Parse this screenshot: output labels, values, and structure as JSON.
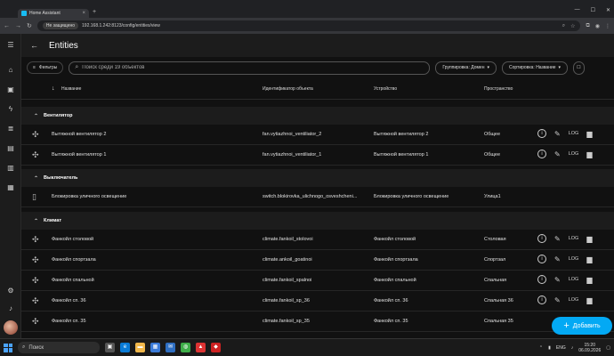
{
  "browser": {
    "tab_title": "Home Assistant",
    "new_tab": "+",
    "security_label": "Не защищено",
    "url": "192.168.1.242:8123/config/entities/view"
  },
  "header": {
    "title": "Entities"
  },
  "toolbar": {
    "filters_label": "Фильтры",
    "search_placeholder": "Поиск среди 19 объектов",
    "group_label": "Группировка: Домен",
    "sort_label": "Сортировка: Название"
  },
  "table": {
    "columns": {
      "name": "Название",
      "entity_id": "Идентификатор объекта",
      "device": "Устройство",
      "area": "Пространство"
    },
    "groups": [
      {
        "label": "Вентилятор",
        "rows": [
          {
            "icon": "fan-icon",
            "name": "Вытяжной вентилятор 2",
            "entity_id": "fan.vytiazhnoi_ventiliator_2",
            "device": "Вытяжной вентилятор 2",
            "area": "Общее"
          },
          {
            "icon": "fan-icon",
            "name": "Вытяжной вентилятор 1",
            "entity_id": "fan.vytiazhnoi_ventiliator_1",
            "device": "Вытяжной вентилятор 1",
            "area": "Общее"
          }
        ]
      },
      {
        "label": "Выключатель",
        "rows": [
          {
            "icon": "switch-icon",
            "name": "Блокировка уличного освещение",
            "entity_id": "switch.blokirovka_ulichnogo_osveshcheni...",
            "device": "Блокировка уличного освещение",
            "area": "Улица1"
          }
        ]
      },
      {
        "label": "Климат",
        "rows": [
          {
            "icon": "fan-icon",
            "name": "Фанкойл столовой",
            "entity_id": "climate.fankoil_stolovoi",
            "device": "Фанкойл столовой",
            "area": "Столовая"
          },
          {
            "icon": "fan-icon",
            "name": "Фанкойл спортзала",
            "entity_id": "climate.ankoil_goatinoi",
            "device": "Фанкойл спортзала",
            "area": "Спортзал"
          },
          {
            "icon": "fan-icon",
            "name": "Фанкойл спальной",
            "entity_id": "climate.fankoil_spalnoi",
            "device": "Фанкойл спальной",
            "area": "Спальная"
          },
          {
            "icon": "fan-icon",
            "name": "Фанкойл сп. 36",
            "entity_id": "climate.fankoil_sp_36",
            "device": "Фанкойл сп. 36",
            "area": "Спальная 36"
          },
          {
            "icon": "fan-icon",
            "name": "Фанкойл сп. 35",
            "entity_id": "climate.fankoil_sp_35",
            "device": "Фанкойл сп. 35",
            "area": "Спальная 35"
          }
        ]
      }
    ],
    "log_label": "LOG"
  },
  "fab": {
    "label": "Добавить"
  },
  "taskbar": {
    "search_label": "Поиск",
    "lang": "ENG",
    "time": "15:20",
    "date": "06.09.2026"
  },
  "colors": {
    "accent": "#03a9f4",
    "background": "#111111"
  }
}
